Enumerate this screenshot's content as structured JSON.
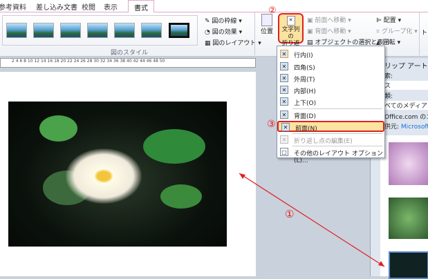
{
  "tabs": [
    "参考資料",
    "差し込み文書",
    "校閲",
    "表示",
    "書式"
  ],
  "ribbon": {
    "picture_styles_group": "図のスタイル",
    "picture_border": "図の枠線",
    "picture_effects": "図の効果",
    "picture_layout": "図のレイアウト",
    "position": "位置",
    "wrap_text_line1": "文字列の",
    "wrap_text_line2": "折り返し",
    "bring_forward": "前面へ移動",
    "send_backward": "背面へ移動",
    "selection_pane": "オブジェクトの選択と表示",
    "align": "配置",
    "group": "グループ化",
    "rotate": "回転",
    "crop": "トリ"
  },
  "ruler_ticks": "2  4  6  8  10  12  14  16  18  20  22  24  26  28  30  32  34  36  38  40  42  44  46  48  50",
  "wrap_menu": {
    "items": [
      {
        "label": "行内(I)",
        "enabled": true
      },
      {
        "label": "四角(S)",
        "enabled": true
      },
      {
        "label": "外周(T)",
        "enabled": true
      },
      {
        "label": "内部(H)",
        "enabled": true
      },
      {
        "label": "上下(O)",
        "enabled": true
      },
      {
        "label": "背面(D)",
        "enabled": true
      },
      {
        "label": "前面(N)",
        "enabled": true,
        "highlighted": true
      },
      {
        "label": "折り返し点の編集(E)",
        "enabled": false
      },
      {
        "label": "その他のレイアウト オプション(L)...",
        "enabled": true
      }
    ]
  },
  "clipart_panel": {
    "title": "リップ アート",
    "search_label": "索:",
    "search_value": "ス",
    "type_label": "類:",
    "type_value": "べてのメディア ファ",
    "office_com": "Office.com のコン",
    "provider_label": "供元:",
    "provider_value": "Microsoft"
  },
  "annotations": {
    "step1": "①",
    "step2": "②",
    "step3": "③"
  },
  "colors": {
    "highlight": "#fbe3a0",
    "annotation": "#e02020"
  }
}
